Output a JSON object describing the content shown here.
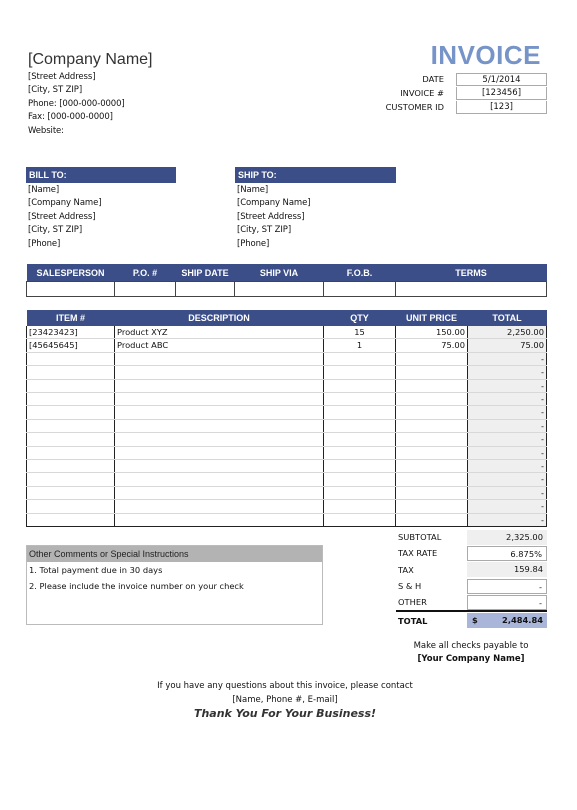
{
  "company": {
    "name": "[Company Name]",
    "lines": [
      "[Street Address]",
      "[City, ST  ZIP]",
      "Phone: [000-000-0000]",
      "Fax: [000-000-0000]",
      "Website:"
    ]
  },
  "title": "INVOICE",
  "meta": [
    {
      "label": "DATE",
      "value": "5/1/2014"
    },
    {
      "label": "INVOICE #",
      "value": "[123456]"
    },
    {
      "label": "CUSTOMER ID",
      "value": "[123]"
    }
  ],
  "bill_to": {
    "heading": "BILL TO:",
    "lines": [
      "[Name]",
      "[Company Name]",
      "[Street Address]",
      "[City, ST  ZIP]",
      "[Phone]"
    ]
  },
  "ship_to": {
    "heading": "SHIP TO:",
    "lines": [
      "[Name]",
      "[Company Name]",
      "[Street Address]",
      "[City, ST  ZIP]",
      "[Phone]"
    ]
  },
  "sales_table": {
    "headers": [
      "SALESPERSON",
      "P.O. #",
      "SHIP DATE",
      "SHIP VIA",
      "F.O.B.",
      "TERMS"
    ],
    "values": [
      "",
      "",
      "",
      "",
      "",
      ""
    ]
  },
  "items_table": {
    "headers": [
      "ITEM #",
      "DESCRIPTION",
      "QTY",
      "UNIT PRICE",
      "TOTAL"
    ],
    "rows": [
      [
        "[23423423]",
        "Product XYZ",
        "15",
        "150.00",
        "2,250.00"
      ],
      [
        "[45645645]",
        "Product ABC",
        "1",
        "75.00",
        "75.00"
      ],
      [
        "",
        "",
        "",
        "",
        "-"
      ],
      [
        "",
        "",
        "",
        "",
        "-"
      ],
      [
        "",
        "",
        "",
        "",
        "-"
      ],
      [
        "",
        "",
        "",
        "",
        "-"
      ],
      [
        "",
        "",
        "",
        "",
        "-"
      ],
      [
        "",
        "",
        "",
        "",
        "-"
      ],
      [
        "",
        "",
        "",
        "",
        "-"
      ],
      [
        "",
        "",
        "",
        "",
        "-"
      ],
      [
        "",
        "",
        "",
        "",
        "-"
      ],
      [
        "",
        "",
        "",
        "",
        "-"
      ],
      [
        "",
        "",
        "",
        "",
        "-"
      ],
      [
        "",
        "",
        "",
        "",
        "-"
      ],
      [
        "",
        "",
        "",
        "",
        "-"
      ]
    ]
  },
  "comments": {
    "heading": "Other Comments or Special Instructions",
    "lines": [
      "1. Total payment due in 30 days",
      "2. Please include the invoice number on your check"
    ]
  },
  "totals": {
    "subtotal_label": "SUBTOTAL",
    "subtotal": "2,325.00",
    "tax_rate_label": "TAX RATE",
    "tax_rate": "6.875%",
    "tax_label": "TAX",
    "tax": "159.84",
    "sh_label": "S & H",
    "sh": "-",
    "other_label": "OTHER",
    "other": "-",
    "total_label": "TOTAL",
    "currency": "$",
    "total": "2,484.84"
  },
  "footer": {
    "payable_line": "Make all checks payable to",
    "payable_name": "[Your Company Name]",
    "contact_line": "If you have any questions about this invoice, please contact",
    "contact_info": "[Name, Phone #, E-mail]",
    "thanks": "Thank You For Your Business!"
  },
  "colors": {
    "header_bar": "#3b4e87",
    "title": "#7694c8",
    "total_highlight": "#a9b6da"
  }
}
